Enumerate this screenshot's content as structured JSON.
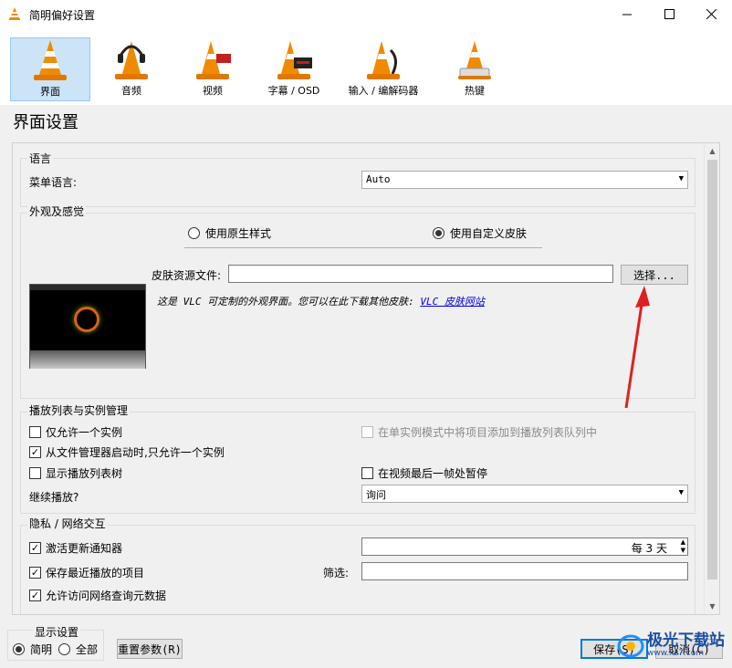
{
  "window": {
    "title": "简明偏好设置",
    "controls": [
      "minimize-icon",
      "maximize-icon",
      "close-icon"
    ]
  },
  "categories": [
    {
      "label": "界面",
      "icon": "vlc-cone-icon",
      "selected": true
    },
    {
      "label": "音频",
      "icon": "headphones-cone-icon"
    },
    {
      "label": "视频",
      "icon": "film-cone-icon"
    },
    {
      "label": "字幕 / OSD",
      "icon": "subtitle-cone-icon"
    },
    {
      "label": "输入 / 编解码器",
      "icon": "cable-cone-icon"
    },
    {
      "label": "热键",
      "icon": "keyboard-cone-icon"
    }
  ],
  "page_title": "界面设置",
  "language": {
    "group_title": "语言",
    "menu_language_label": "菜单语言:",
    "menu_language_value": "Auto"
  },
  "look_feel": {
    "group_title": "外观及感觉",
    "native_style_label": "使用原生样式",
    "custom_skin_label": "使用自定义皮肤",
    "selected": "custom_skin",
    "skin_file_label": "皮肤资源文件:",
    "skin_file_value": "",
    "choose_button": "选择...",
    "note_text": "这是 VLC 可定制的外观界面。您可以在此下载其他皮肤:",
    "note_link": "VLC 皮肤网站"
  },
  "playlist": {
    "group_title": "播放列表与实例管理",
    "allow_one_instance": {
      "label": "仅允许一个实例",
      "checked": false
    },
    "enqueue_one_instance": {
      "label": "在单实例模式中将项目添加到播放列表队列中",
      "checked": false,
      "disabled": true
    },
    "one_instance_file_manager": {
      "label": "从文件管理器启动时,只允许一个实例",
      "checked": true
    },
    "show_playlist_tree": {
      "label": "显示播放列表树",
      "checked": false
    },
    "pause_last_frame": {
      "label": "在视频最后一帧处暂停",
      "checked": false
    },
    "continue_playback_label": "继续播放?",
    "continue_playback_value": "询问"
  },
  "privacy": {
    "group_title": "隐私 / 网络交互",
    "update_notifier": {
      "label": "激活更新通知器",
      "checked": true
    },
    "update_interval_value": "每 3 天",
    "save_recent": {
      "label": "保存最近播放的项目",
      "checked": true
    },
    "filter_label": "筛选:",
    "filter_value": "",
    "allow_metadata": {
      "label": "允许访问网络查询元数据",
      "checked": true
    }
  },
  "footer": {
    "show_settings_title": "显示设置",
    "simple_label": "简明",
    "all_label": "全部",
    "mode_selected": "simple",
    "reset_button": "重置参数(R)",
    "save_button": "保存(S)",
    "cancel_button": "取消(C)"
  },
  "watermark": {
    "text": "极光下载站",
    "sub": "www.xz7.com"
  },
  "colors": {
    "accent": "#0078d7",
    "selected_tab": "#cce4f7",
    "arrow": "#e02020",
    "link": "#0000ee",
    "vlc_orange": "#f08a00"
  }
}
